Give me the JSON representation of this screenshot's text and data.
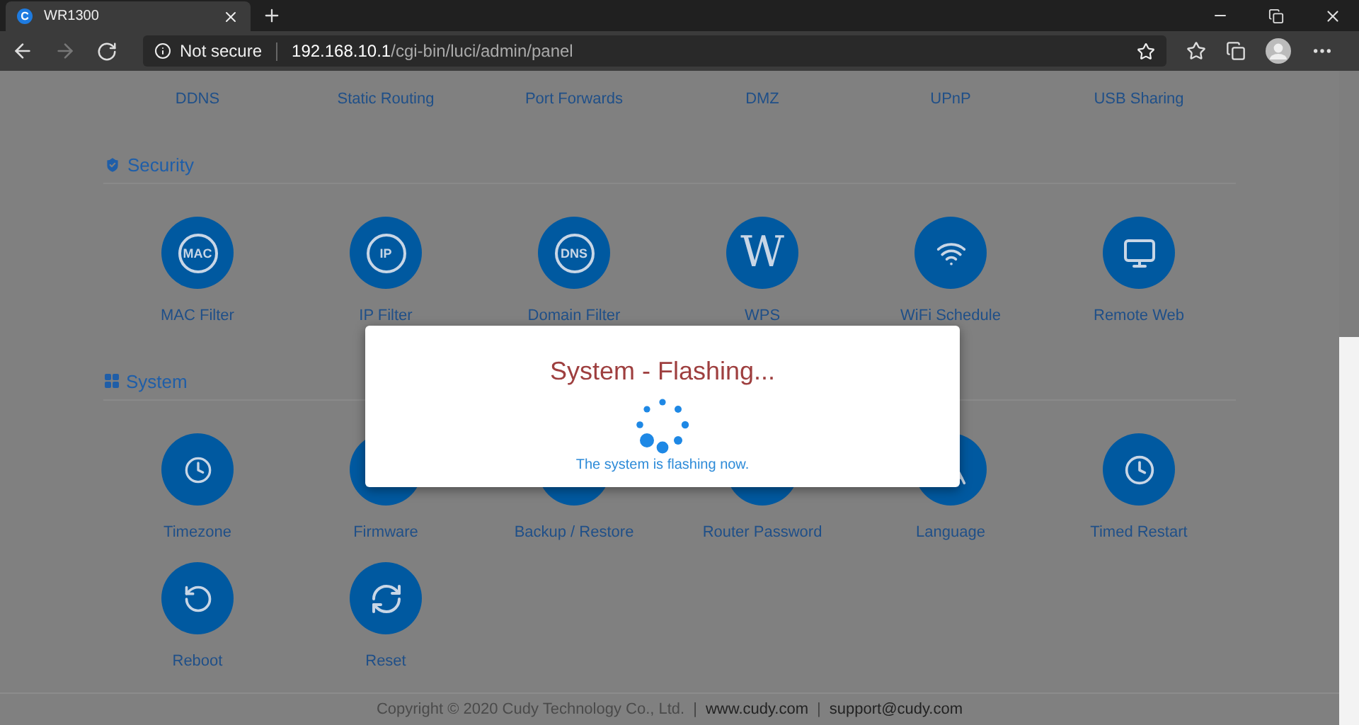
{
  "browser": {
    "tab": {
      "title": "WR1300",
      "favicon": "C"
    },
    "address": {
      "security": "Not secure",
      "host": "192.168.10.1",
      "path": "/cgi-bin/luci/admin/panel"
    }
  },
  "top_row": [
    {
      "label": "DDNS"
    },
    {
      "label": "Static Routing"
    },
    {
      "label": "Port Forwards"
    },
    {
      "label": "DMZ"
    },
    {
      "label": "UPnP"
    },
    {
      "label": "USB Sharing"
    }
  ],
  "sections": [
    {
      "title": "Security",
      "items": [
        {
          "label": "MAC Filter",
          "icon_text": "MAC"
        },
        {
          "label": "IP Filter",
          "icon_text": "IP"
        },
        {
          "label": "Domain Filter",
          "icon_text": "DNS"
        },
        {
          "label": "WPS",
          "icon_text": "W"
        },
        {
          "label": "WiFi Schedule"
        },
        {
          "label": "Remote Web"
        }
      ]
    },
    {
      "title": "System",
      "items": [
        {
          "label": "Timezone"
        },
        {
          "label": "Firmware"
        },
        {
          "label": "Backup / Restore"
        },
        {
          "label": "Router Password"
        },
        {
          "label": "Language"
        },
        {
          "label": "Timed Restart"
        },
        {
          "label": "Reboot"
        },
        {
          "label": "Reset"
        }
      ]
    }
  ],
  "modal": {
    "title": "System - Flashing...",
    "message": "The system is flashing now."
  },
  "footer": {
    "copyright": "Copyright © 2020 Cudy Technology Co., Ltd.",
    "separator": "|",
    "links": [
      "www.cudy.com",
      "support@cudy.com"
    ]
  }
}
